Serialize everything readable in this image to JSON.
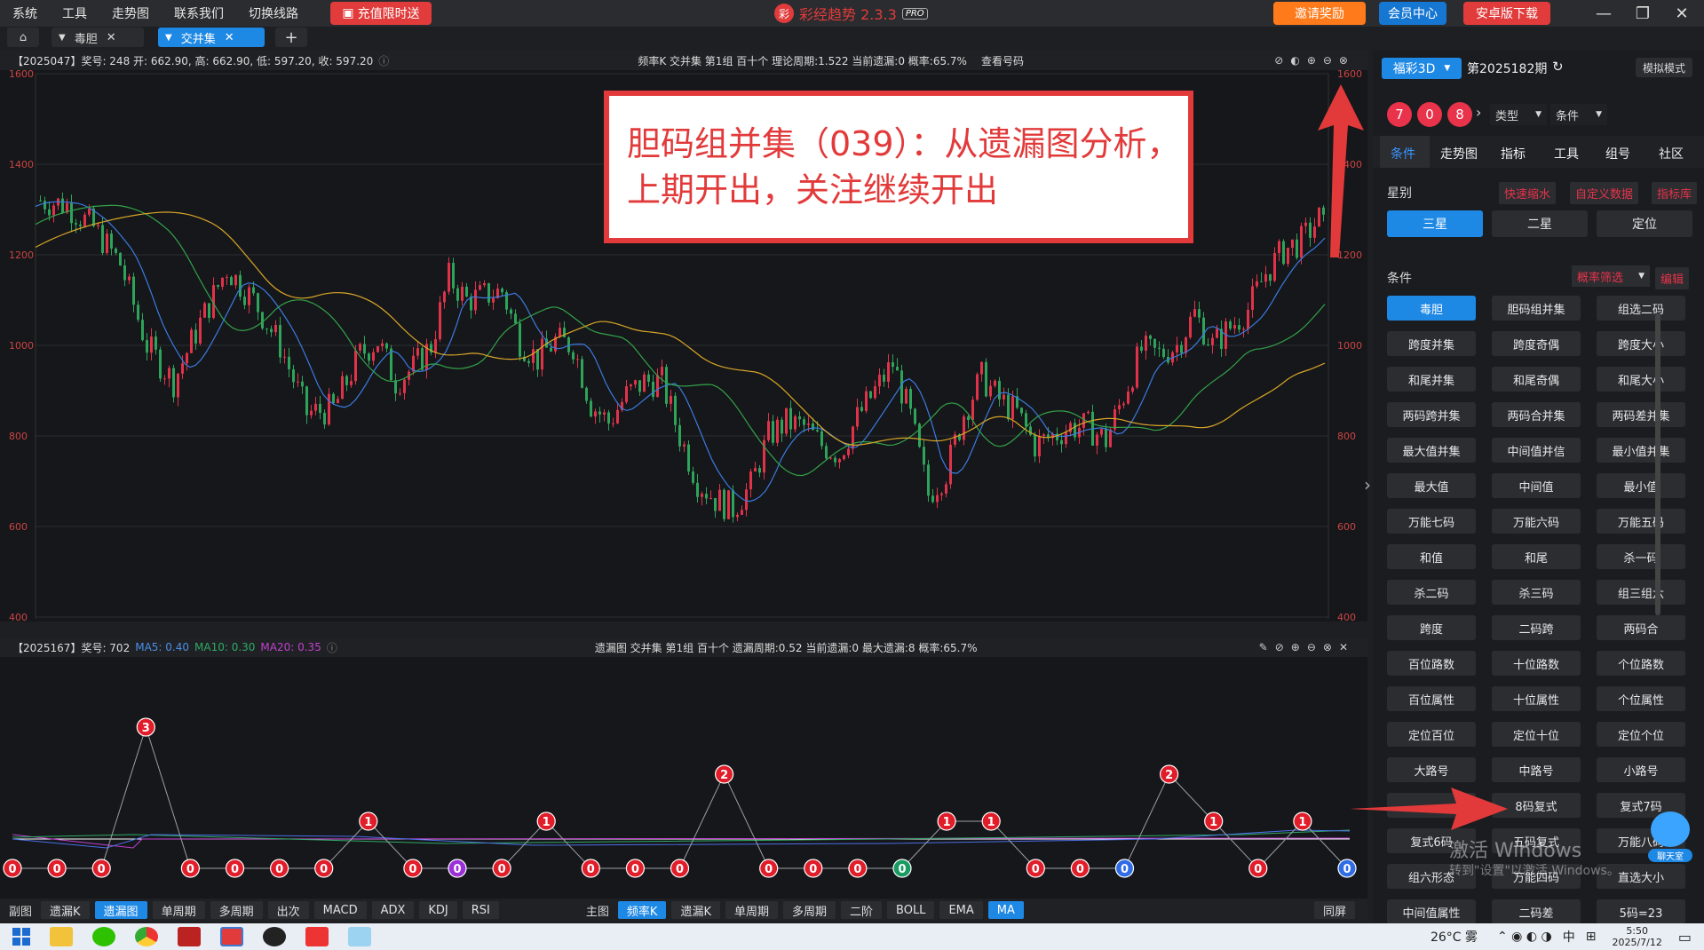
{
  "menu": {
    "items": [
      "系统",
      "工具",
      "走势图",
      "联系我们",
      "切换线路"
    ],
    "promo": "充值限时送"
  },
  "app": {
    "title": "彩经趋势 2.3.3",
    "badge": "PRO",
    "invite": "邀请奖励",
    "member": "会员中心",
    "android": "安卓版下载"
  },
  "tabs": [
    {
      "label": "毒胆"
    },
    {
      "label": "交并集"
    }
  ],
  "chart_header": {
    "left": "【2025047】奖号: 248  开: 662.90, 高: 662.90, 低: 597.20, 收: 597.20",
    "center": "频率K  交并集  第1组  百十个  理论周期:1.522  当前遗漏:0  概率:65.7%",
    "link": "查看号码"
  },
  "sub_header": {
    "left_prefix": "【2025167】奖号: 702",
    "ma5": "MA5: 0.40",
    "ma10": "MA10: 0.30",
    "ma20": "MA20: 0.35",
    "center": "遗漏图  交并集  第1组  百十个  遗漏周期:0.52  当前遗漏:0  最大遗漏:8  概率:65.7%"
  },
  "y_axis": [
    "1600",
    "1400",
    "1200",
    "1000",
    "800",
    "600",
    "400"
  ],
  "annotation": {
    "line1": "胆码组并集（039）：从遗漏图分析，",
    "line2": "上期开出，关注继续开出"
  },
  "omission_values": [
    "0",
    "0",
    "0",
    "3",
    "0",
    "0",
    "0",
    "0",
    "1",
    "0",
    "0",
    "0",
    "1",
    "0",
    "0",
    "0",
    "2",
    "0",
    "0",
    "0",
    "0",
    "1",
    "1",
    "0",
    "0",
    "0",
    "2",
    "1",
    "0",
    "1",
    "0"
  ],
  "bottom_left": {
    "label": "副图",
    "tabs": [
      "遗漏K",
      "遗漏图",
      "单周期",
      "多周期",
      "出次",
      "MACD",
      "ADX",
      "KDJ",
      "RSI"
    ]
  },
  "bottom_right": {
    "label": "主图",
    "tabs": [
      "频率K",
      "遗漏K",
      "单周期",
      "多周期",
      "二阶",
      "BOLL",
      "EMA",
      "MA"
    ],
    "same_screen": "同屏"
  },
  "right": {
    "lottery": "福彩3D",
    "period": "第2025182期",
    "mode": "模拟模式",
    "balls": [
      "7",
      "0",
      "8"
    ],
    "type_select": "类型",
    "cond_select": "条件",
    "tabs": [
      "条件",
      "走势图",
      "指标",
      "工具",
      "组号",
      "社区"
    ],
    "star_label": "星别",
    "star_links": [
      "快速缩水",
      "自定义数据",
      "指标库"
    ],
    "stars": [
      "三星",
      "二星",
      "定位"
    ],
    "cond_label": "条件",
    "prob_filter": "概率筛选",
    "edit": "编辑",
    "buttons": [
      "毒胆",
      "胆码组并集",
      "组选二码",
      "跨度并集",
      "跨度奇偶",
      "跨度大小",
      "和尾并集",
      "和尾奇偶",
      "和尾大小",
      "两码跨并集",
      "两码合并集",
      "两码差并集",
      "最大值并集",
      "中间值并信",
      "最小值并集",
      "最大值",
      "中间值",
      "最小值",
      "万能七码",
      "万能六码",
      "万能五码",
      "和值",
      "和尾",
      "杀一码",
      "杀二码",
      "杀三码",
      "组三组六",
      "跨度",
      "二码跨",
      "两码合",
      "百位路数",
      "十位路数",
      "个位路数",
      "百位属性",
      "十位属性",
      "个位属性",
      "定位百位",
      "定位十位",
      "定位个位",
      "大路号",
      "中路号",
      "小路号",
      "",
      "8码复式",
      "复式7码",
      "复式6码",
      "五码复式",
      "万能八码",
      "组六形态",
      "万能四码",
      "直选大小",
      "中间值属性",
      "二码差",
      "5码=23"
    ],
    "chat": "聊天室"
  },
  "watermark": {
    "line1": "激活 Windows",
    "line2": "转到\"设置\"以激活 Windows。"
  },
  "taskbar": {
    "weather": "26°C 雾",
    "time": "5:50",
    "date": "2025/7/12",
    "ime": "中"
  }
}
